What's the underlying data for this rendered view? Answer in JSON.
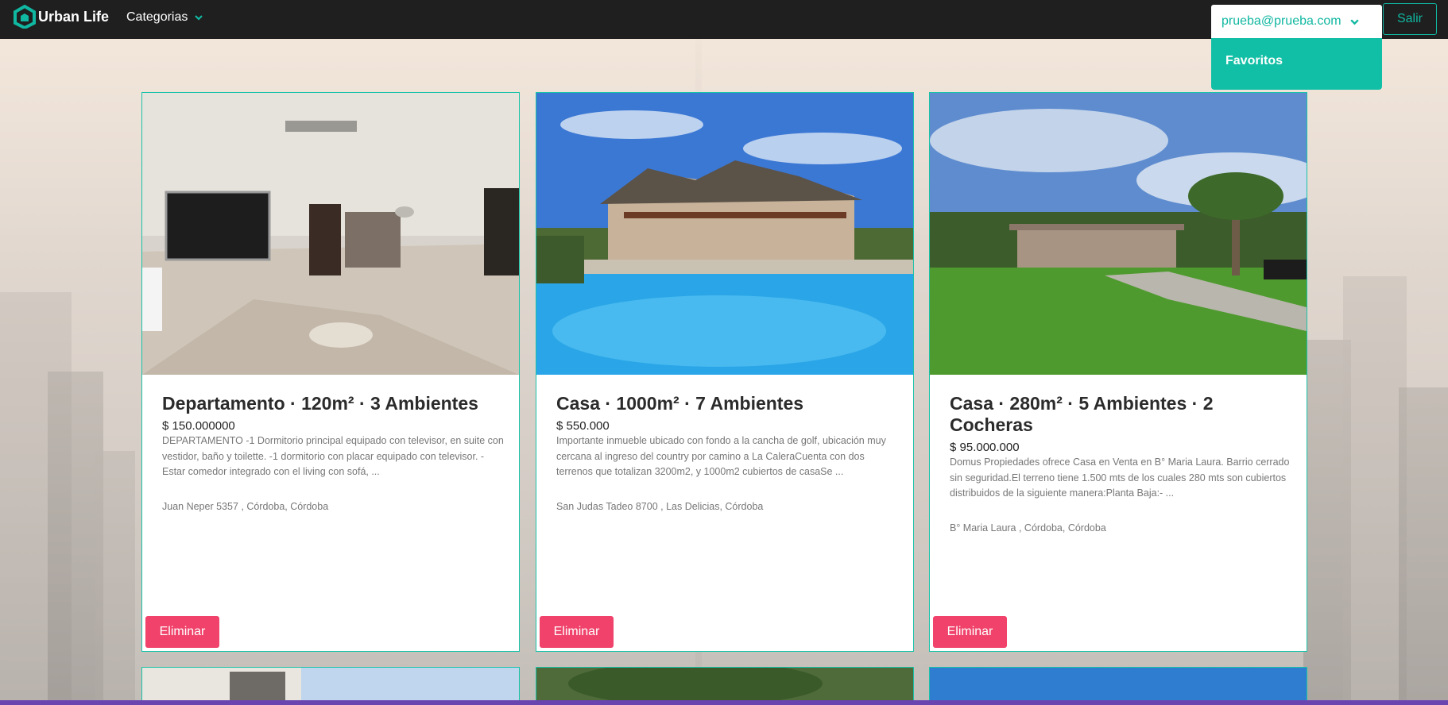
{
  "brand": {
    "name": "Urban Life",
    "accent": "#10b7a1"
  },
  "nav": {
    "categories_label": "Categorias",
    "user_email": "prueba@prueba.com",
    "logout_label": "Salir"
  },
  "user_menu": {
    "items": [
      {
        "label": "Favoritos"
      }
    ]
  },
  "listings": [
    {
      "title": "Departamento · 120m² · 3 Ambientes",
      "price": "$ 150.000000",
      "description": "DEPARTAMENTO -1 Dormitorio principal equipado con televisor, en suite con vestidor, baño y toilette. -1 dormitorio con placar equipado con televisor. -Estar comedor integrado con el living con sofá, ...",
      "address": "Juan Neper 5357 , Córdoba, Córdoba",
      "delete_label": "Eliminar"
    },
    {
      "title": "Casa · 1000m² · 7 Ambientes",
      "price": "$ 550.000",
      "description": "Importante inmueble ubicado con fondo a la cancha de golf, ubicación muy cercana al ingreso del country por camino a La CaleraCuenta con dos terrenos que totalizan 3200m2, y 1000m2 cubiertos de casaSe ...",
      "address": "San Judas Tadeo 8700 , Las Delicias, Córdoba",
      "delete_label": "Eliminar"
    },
    {
      "title": "Casa · 280m² · 5 Ambientes · 2 Cocheras",
      "price": "$ 95.000.000",
      "description": "Domus Propiedades ofrece Casa en Venta en B° Maria Laura. Barrio cerrado sin seguridad.El terreno tiene 1.500 mts de los cuales 280 mts son cubiertos distribuidos de la siguiente manera:Planta Baja:- ...",
      "address": "B° Maria Laura , Córdoba, Córdoba",
      "delete_label": "Eliminar"
    }
  ],
  "colors": {
    "navbar": "#1f1f1f",
    "accent": "#10b7a1",
    "delete": "#f0426a",
    "card_border": "#18c3a8"
  }
}
